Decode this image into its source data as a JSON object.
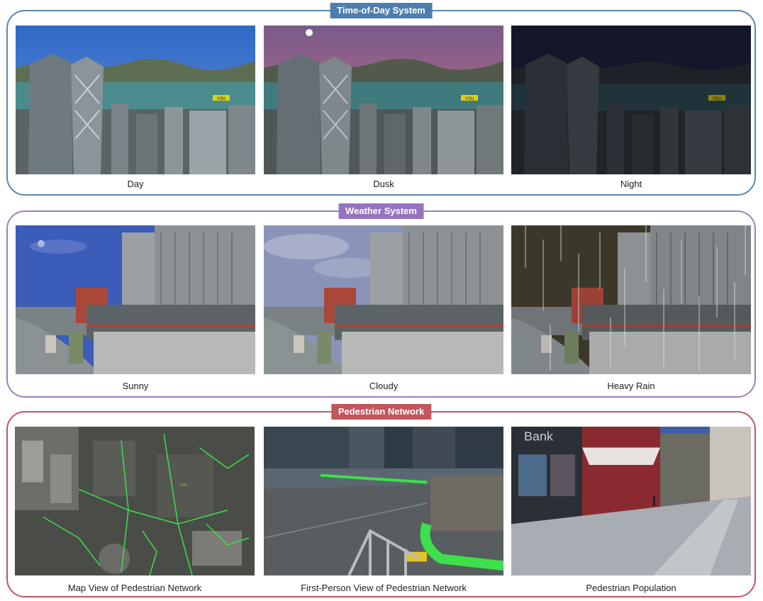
{
  "sections": {
    "time_of_day": {
      "title": "Time-of-Day System",
      "captions": [
        "Day",
        "Dusk",
        "Night"
      ]
    },
    "weather": {
      "title": "Weather System",
      "captions": [
        "Sunny",
        "Cloudy",
        "Heavy Rain"
      ]
    },
    "pedestrian": {
      "title": "Pedestrian Network",
      "captions": [
        "Map View of Pedestrian Network",
        "First-Person View of Pedestrian Network",
        "Pedestrian Population"
      ]
    }
  },
  "scene_labels": {
    "you_marker": "YOU",
    "storefront_sign": "Bank"
  },
  "colors": {
    "time_of_day_accent": "#4c7fae",
    "weather_accent": "#9474c0",
    "pedestrian_accent": "#c3555d",
    "network_path": "#3de04a"
  }
}
